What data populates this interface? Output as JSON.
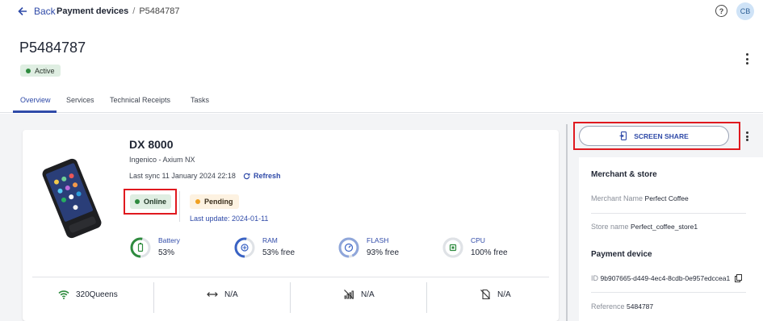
{
  "nav": {
    "back_label": "Back"
  },
  "breadcrumb": {
    "parent": "Payment devices",
    "separator": "/",
    "current": "P5484787"
  },
  "user": {
    "initials": "CB"
  },
  "header": {
    "title": "P5484787",
    "status": "Active"
  },
  "tabs": [
    {
      "label": "Overview",
      "active": true
    },
    {
      "label": "Services",
      "active": false
    },
    {
      "label": "Technical Receipts",
      "active": false
    },
    {
      "label": "Tasks",
      "active": false
    }
  ],
  "device": {
    "name": "DX 8000",
    "manufacturer": "Ingenico - Axium NX",
    "last_sync": "Last sync 11 January 2024 22:18",
    "refresh_label": "Refresh",
    "online_status": "Online",
    "pending_status": "Pending",
    "last_update": "Last update: 2024-01-11",
    "metrics": [
      {
        "label": "Battery",
        "value": "53%",
        "level": 0.53,
        "icon": "battery-icon"
      },
      {
        "label": "RAM",
        "value": "53% free",
        "level": 0.53,
        "icon": "ram-icon"
      },
      {
        "label": "FLASH",
        "value": "93% free",
        "level": 0.93,
        "icon": "flash-icon"
      },
      {
        "label": "CPU",
        "value": "100% free",
        "level": 1.0,
        "icon": "cpu-icon"
      }
    ],
    "connectivity": [
      {
        "label": "320Queens",
        "icon": "wifi-icon"
      },
      {
        "label": "N/A",
        "icon": "ethernet-icon"
      },
      {
        "label": "N/A",
        "icon": "no-cellular-signal-icon"
      },
      {
        "label": "N/A",
        "icon": "no-sim-card-icon"
      }
    ]
  },
  "side_panel": {
    "screen_share_label": "SCREEN SHARE",
    "merchant_section": "Merchant & store",
    "merchant_name_label": "Merchant Name",
    "merchant_name": "Perfect Coffee",
    "store_name_label": "Store name",
    "store_name": "Perfect_coffee_store1",
    "device_section": "Payment device",
    "id_label": "ID",
    "id_value": "9b907665-d449-4ec4-8cdb-0e957edccea1",
    "reference_label": "Reference",
    "reference_value": "5484787"
  },
  "colors": {
    "accent": "#2f4aa8",
    "online": "#2e8b3e",
    "pending": "#f0a020",
    "highlight": "#e0191f"
  }
}
